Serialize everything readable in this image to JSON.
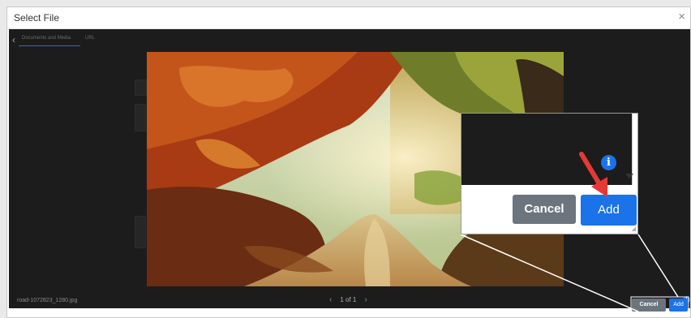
{
  "dialog": {
    "title": "Select File",
    "close_glyph": "×"
  },
  "viewer": {
    "tabs": [
      "Documents and Media",
      "URL"
    ],
    "back_glyph": "‹",
    "filename": "road-1072823_1280.jpg",
    "pager": {
      "prev": "‹",
      "label": "1 of 1",
      "next": "›"
    },
    "info_glyph": "i"
  },
  "footer": {
    "cancel_label": "Cancel",
    "add_label": "Add"
  },
  "zoom_callout": {
    "info_glyph": "i",
    "cancel_label": "Cancel",
    "add_label": "Add"
  },
  "colors": {
    "primary": "#1a73e8",
    "secondary": "#6c757d",
    "annotation_arrow": "#e53935"
  },
  "icons": [
    "close-icon",
    "chevron-left-icon",
    "chevron-right-icon",
    "info-icon",
    "caret-down-icon",
    "arrow-annotation-icon"
  ]
}
